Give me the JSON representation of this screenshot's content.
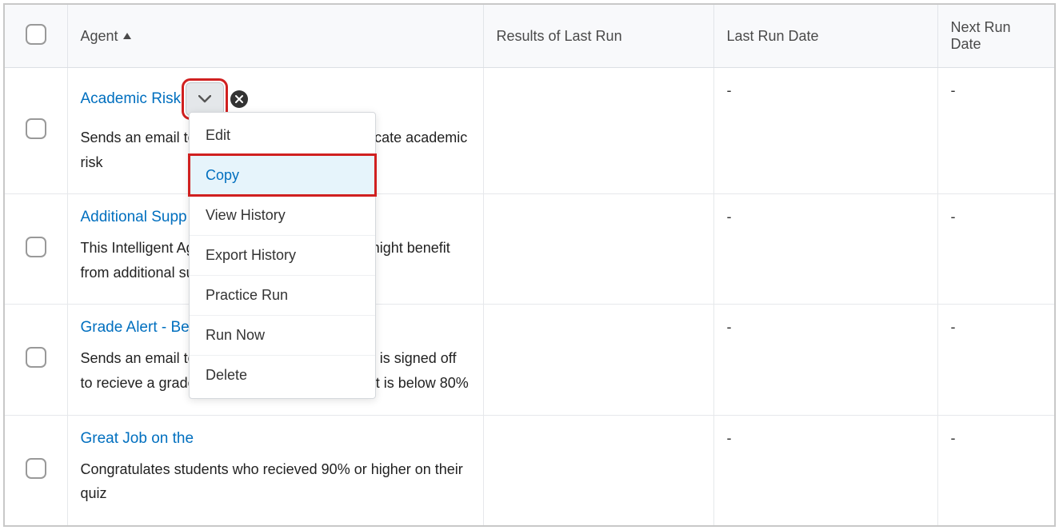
{
  "columns": {
    "agent": "Agent",
    "results": "Results of Last Run",
    "lastRun": "Last Run Date",
    "nextRun": "Next Run Date"
  },
  "rows": [
    {
      "title": "Academic Risk",
      "desc": "Sends an email to the student's Advisor to indicate academic risk",
      "results": "",
      "lastRun": "-",
      "nextRun": "-"
    },
    {
      "title": "Additional Supp",
      "title_suffix": " might benefit from ad",
      "desc_prefix": "This Intelligent ",
      "desc": "This Intelligent Agent identifies students who might benefit from additional support",
      "results": "",
      "lastRun": "-",
      "nextRun": "-"
    },
    {
      "title": "Grade Alert - Be",
      "desc": "Sends an email to students when a discussion is signed off to recieve a grade on the discussion forum that is below 80%",
      "desc_visible_part1": "Sends an email ",
      "desc_visible_mid": "l off to recieve a grade ",
      "desc_visible_end": "low 80%",
      "results": "",
      "lastRun": "-",
      "nextRun": "-"
    },
    {
      "title": "Great Job on the",
      "desc": "Congratulates students who recieved 90% or higher on their quiz",
      "desc_visible_part1": "Congratulates s",
      "desc_visible_end": "% on their quiz",
      "results": "",
      "lastRun": "-",
      "nextRun": "-"
    }
  ],
  "menu": {
    "edit": "Edit",
    "copy": "Copy",
    "viewHistory": "View History",
    "exportHistory": "Export History",
    "practiceRun": "Practice Run",
    "runNow": "Run Now",
    "delete": "Delete"
  }
}
